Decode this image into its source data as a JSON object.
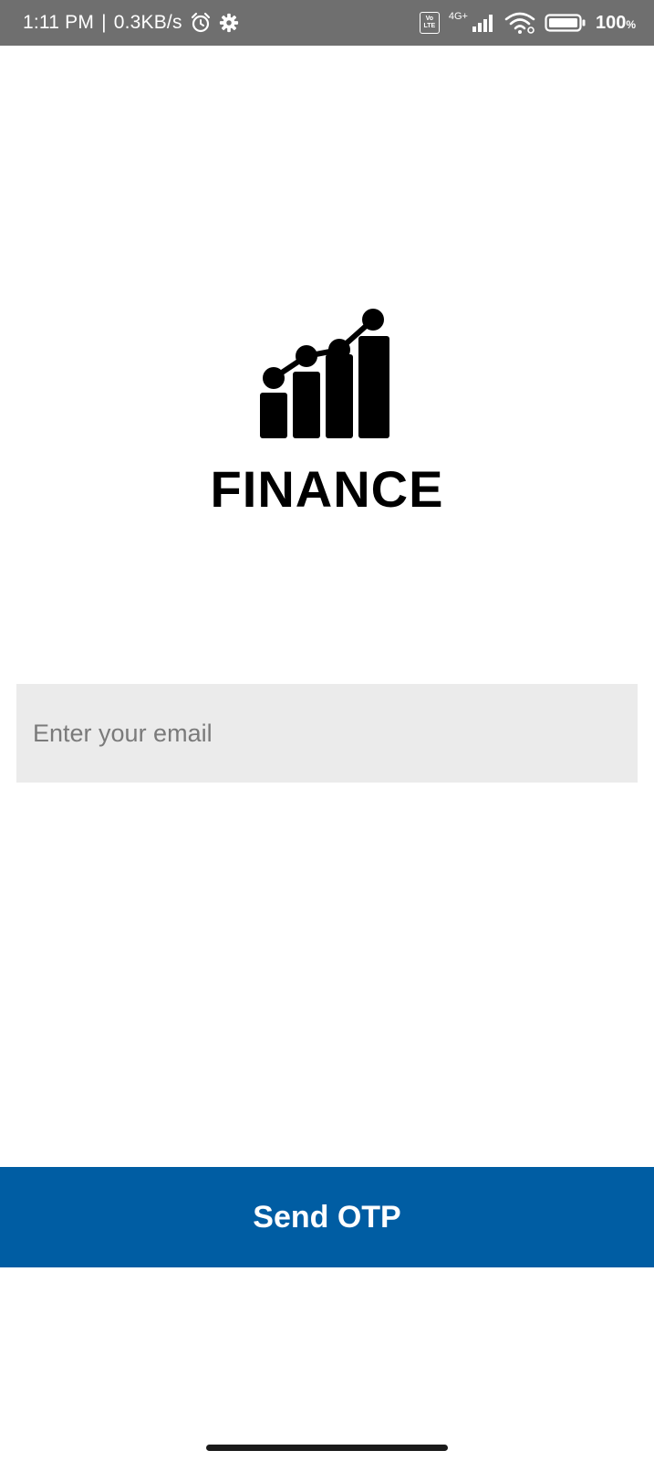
{
  "status_bar": {
    "time": "1:11 PM",
    "separator": "|",
    "speed": "0.3KB/s",
    "volte_top": "Vo",
    "volte_bottom": "LTE",
    "network_type": "4G+",
    "battery_percent": "100",
    "battery_unit": "%",
    "icons": [
      "alarm-icon",
      "gear-icon",
      "volte-icon",
      "signal-icon",
      "wifi-icon",
      "battery-icon"
    ]
  },
  "logo": {
    "title": "FINANCE",
    "icon": "finance-chart-icon"
  },
  "form": {
    "email_placeholder": "Enter your email",
    "email_value": ""
  },
  "actions": {
    "send_label": "Send OTP",
    "send_color": "#005da3"
  }
}
